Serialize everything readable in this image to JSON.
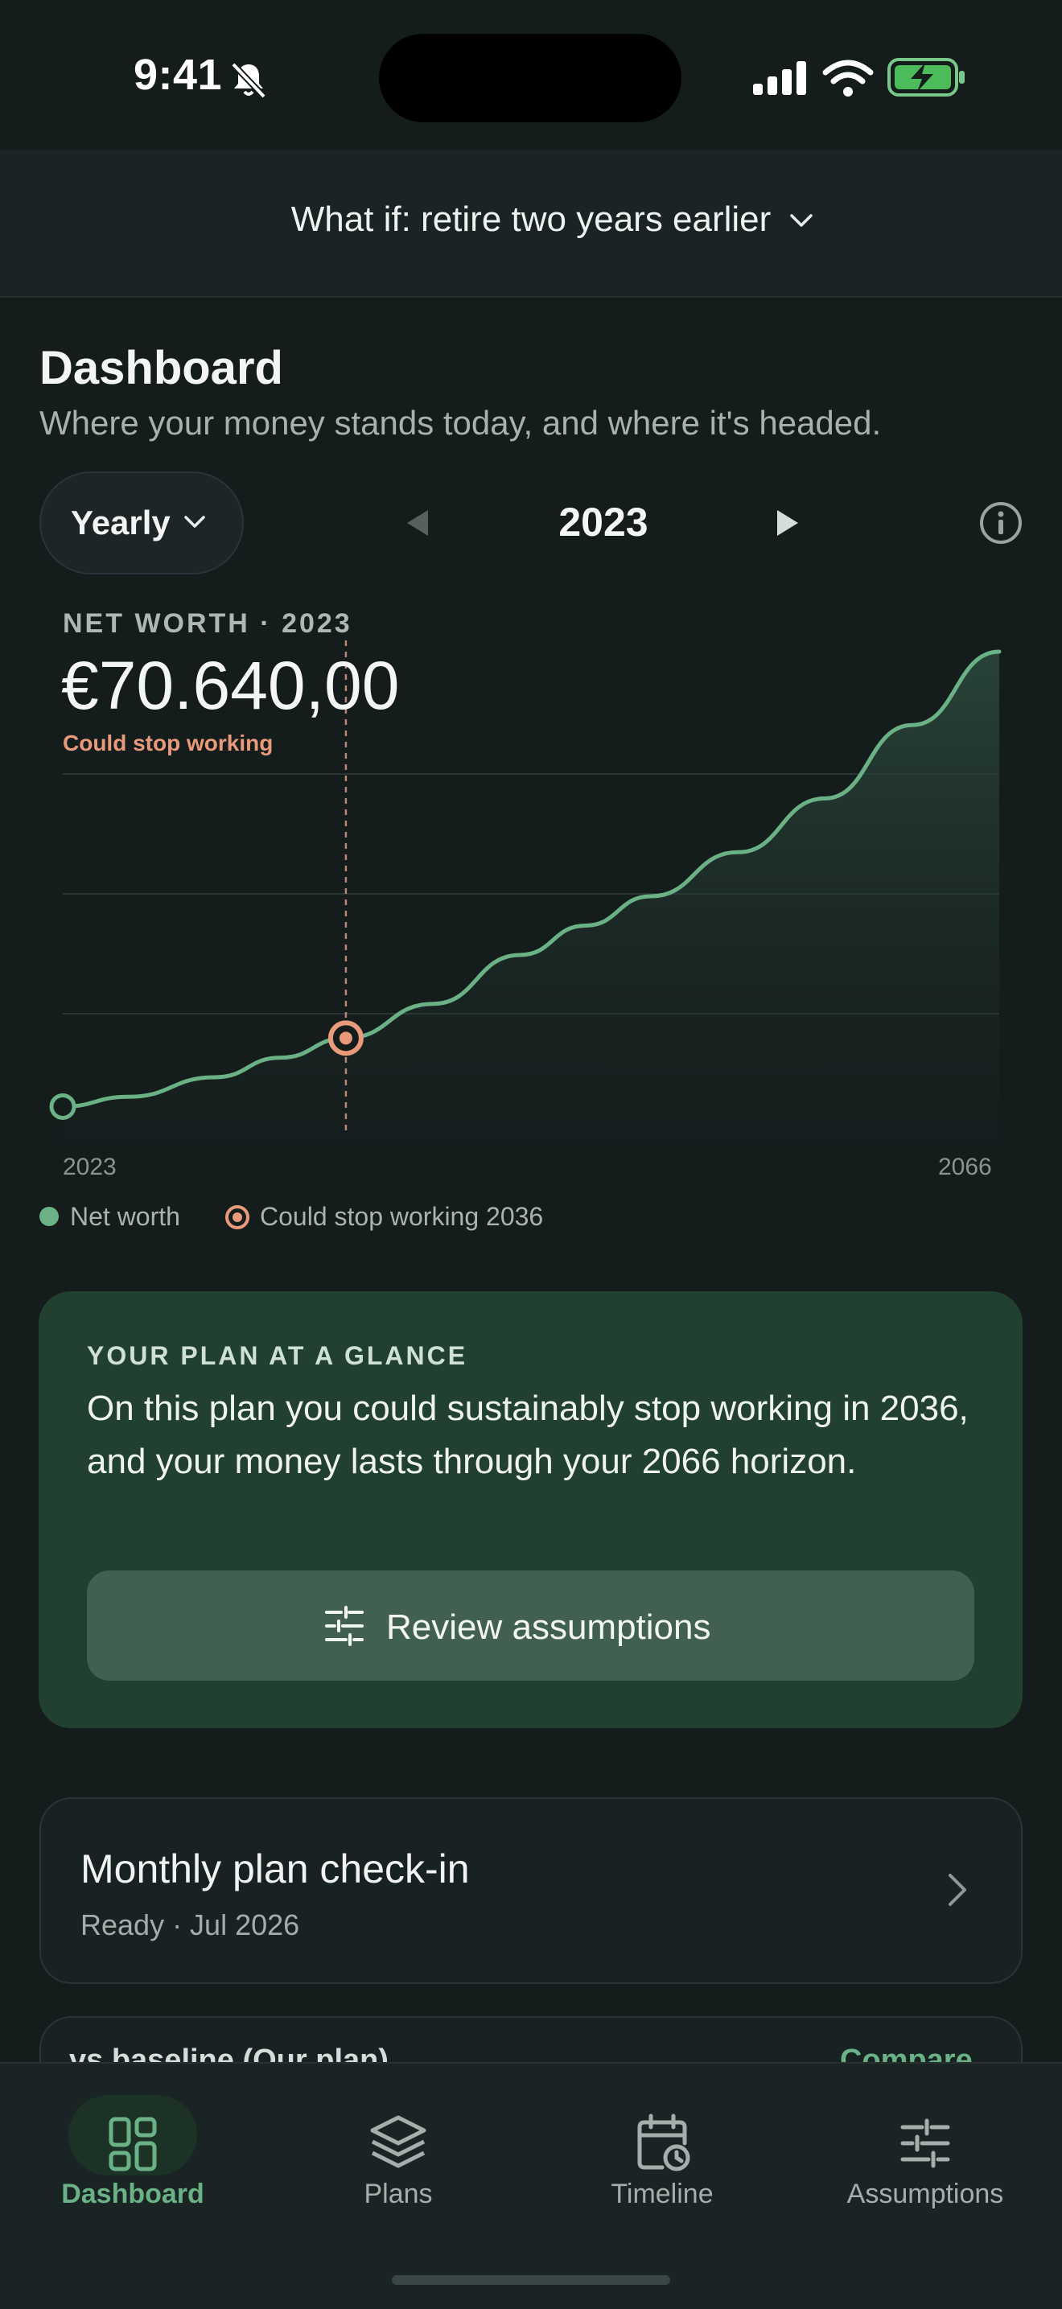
{
  "status_bar": {
    "time": "9:41"
  },
  "scenario": {
    "label": "What if: retire two years earlier"
  },
  "page": {
    "title": "Dashboard",
    "subtitle": "Where your money stands today, and where it's headed."
  },
  "controls": {
    "period": "Yearly",
    "year": "2023"
  },
  "chart": {
    "kicker": "NET WORTH · 2023",
    "value": "€70.640,00",
    "note": "Could stop working",
    "x_start_label": "2023",
    "x_end_label": "2066",
    "legend_net_worth": "Net worth",
    "legend_stop": "Could stop working 2036"
  },
  "chart_data": {
    "type": "area",
    "series": [
      {
        "name": "Net worth",
        "x": [
          2023,
          2026,
          2030,
          2033,
          2036,
          2040,
          2044,
          2047,
          2050,
          2054,
          2058,
          2062,
          2066
        ],
        "values": [
          0.07,
          0.09,
          0.13,
          0.17,
          0.21,
          0.28,
          0.38,
          0.44,
          0.5,
          0.59,
          0.7,
          0.85,
          1.0
        ]
      }
    ],
    "markers": [
      {
        "label": "Could stop working 2036",
        "x": 2036
      }
    ],
    "xlim": [
      2023,
      2066
    ],
    "grid": true,
    "colors": {
      "line": "#6ab285",
      "marker": "#e89a7a"
    }
  },
  "glance": {
    "kicker": "YOUR PLAN AT A GLANCE",
    "body": "On this plan you could sustainably stop working in 2036, and your money lasts through your 2066 horizon.",
    "button": "Review assumptions"
  },
  "checkin": {
    "title": "Monthly plan check-in",
    "subtitle": "Ready · Jul 2026"
  },
  "peek": {
    "left": "vs baseline (Our plan)",
    "right": "Compare"
  },
  "tabs": [
    {
      "label": "Dashboard",
      "icon": "dashboard-icon",
      "active": true
    },
    {
      "label": "Plans",
      "icon": "layers-icon",
      "active": false
    },
    {
      "label": "Timeline",
      "icon": "calendar-clock-icon",
      "active": false
    },
    {
      "label": "Assumptions",
      "icon": "sliders-icon",
      "active": false
    }
  ],
  "colors": {
    "accent": "#6ab285",
    "warning": "#e89a7a",
    "card": "#22402f"
  }
}
